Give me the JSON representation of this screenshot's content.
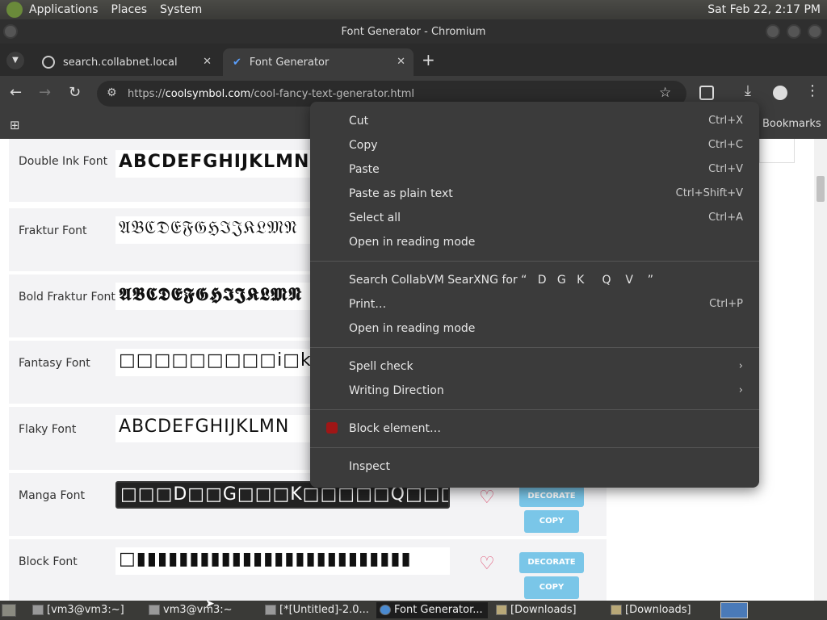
{
  "panel": {
    "applications": "Applications",
    "places": "Places",
    "system": "System",
    "clock": "Sat Feb 22,  2:17 PM"
  },
  "window": {
    "title": "Font Generator - Chromium"
  },
  "tabs": [
    {
      "label": "search.collabnet.local"
    },
    {
      "label": "Font Generator"
    }
  ],
  "toolbar": {
    "url_scheme": "https://",
    "url_host": "coolsymbol.com",
    "url_path": "/cool-fancy-text-generator.html"
  },
  "bookmarks": {
    "label": "Bookmarks"
  },
  "fonts": [
    {
      "name": "Double Ink Font",
      "sample": "ABCDEFGHIJKLMNO"
    },
    {
      "name": "Fraktur Font",
      "sample": "𝔄𝔅ℭ𝔇𝔈𝔉𝔊ℌℑ𝔍𝔎𝔏𝔐𝔑"
    },
    {
      "name": "Bold Fraktur Font",
      "sample": "𝕬𝕭𝕮𝕯𝕰𝕱𝕲𝕳𝕴𝕵𝕶𝕷𝕸𝕹"
    },
    {
      "name": "Fantasy Font",
      "sample": "□□□□□□□□□i□k□□□□"
    },
    {
      "name": "Flaky Font",
      "sample": "ABCDEFGHIJKLMN"
    },
    {
      "name": "Manga Font",
      "sample": "□□□D□□G□□□K□□□□□Q□□□□V"
    },
    {
      "name": "Block Font",
      "sample": "□▮▮▮▮▮▮▮▮▮▮▮▮▮▮▮▮▮▮▮▮▮▮▮▮▮▮"
    }
  ],
  "buttons": {
    "decorate": "DECORATE",
    "copy": "COPY"
  },
  "context_menu": {
    "cut": "Cut",
    "cut_sc": "Ctrl+X",
    "copy": "Copy",
    "copy_sc": "Ctrl+C",
    "paste": "Paste",
    "paste_sc": "Ctrl+V",
    "paste_plain": "Paste as plain text",
    "paste_plain_sc": "Ctrl+Shift+V",
    "select_all": "Select all",
    "select_all_sc": "Ctrl+A",
    "reading_mode": "Open in reading mode",
    "search": "Search CollabVM SearXNG for “   D   G   K     Q    V    ”",
    "print": "Print…",
    "print_sc": "Ctrl+P",
    "reading_mode2": "Open in reading mode",
    "spell_check": "Spell check",
    "writing_direction": "Writing Direction",
    "block_element": "Block element…",
    "inspect": "Inspect"
  },
  "taskbar": [
    {
      "label": "[vm3@vm3:~]"
    },
    {
      "label": "vm3@vm3:~"
    },
    {
      "label": "[*[Untitled]-2.0..."
    },
    {
      "label": "Font Generator..."
    },
    {
      "label": "[Downloads]"
    },
    {
      "label": "[Downloads]"
    }
  ]
}
